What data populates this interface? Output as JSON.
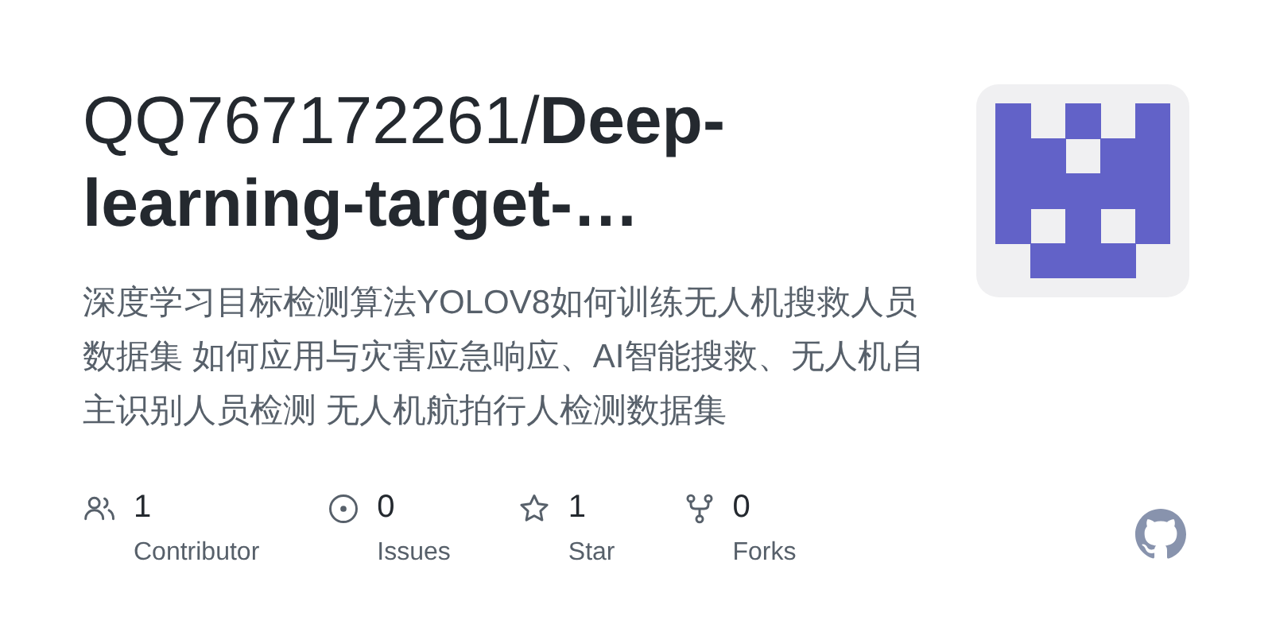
{
  "title": "QQ767172261/**Deep-learning-target-…**",
  "description": "深度学习目标检测算法YOLOV8如何训练无人机搜救人员数据集 如何应用与灾害应急响应、AI智能搜救、无人机自主识别人员检测 无人机航拍行人检测数据集",
  "stats": [
    {
      "kind": "people",
      "count": "1",
      "label": "Contributor"
    },
    {
      "kind": "issue",
      "count": "0",
      "label": "Issues"
    },
    {
      "kind": "star",
      "count": "1",
      "label": "Star"
    },
    {
      "kind": "fork",
      "count": "0",
      "label": "Forks"
    }
  ]
}
